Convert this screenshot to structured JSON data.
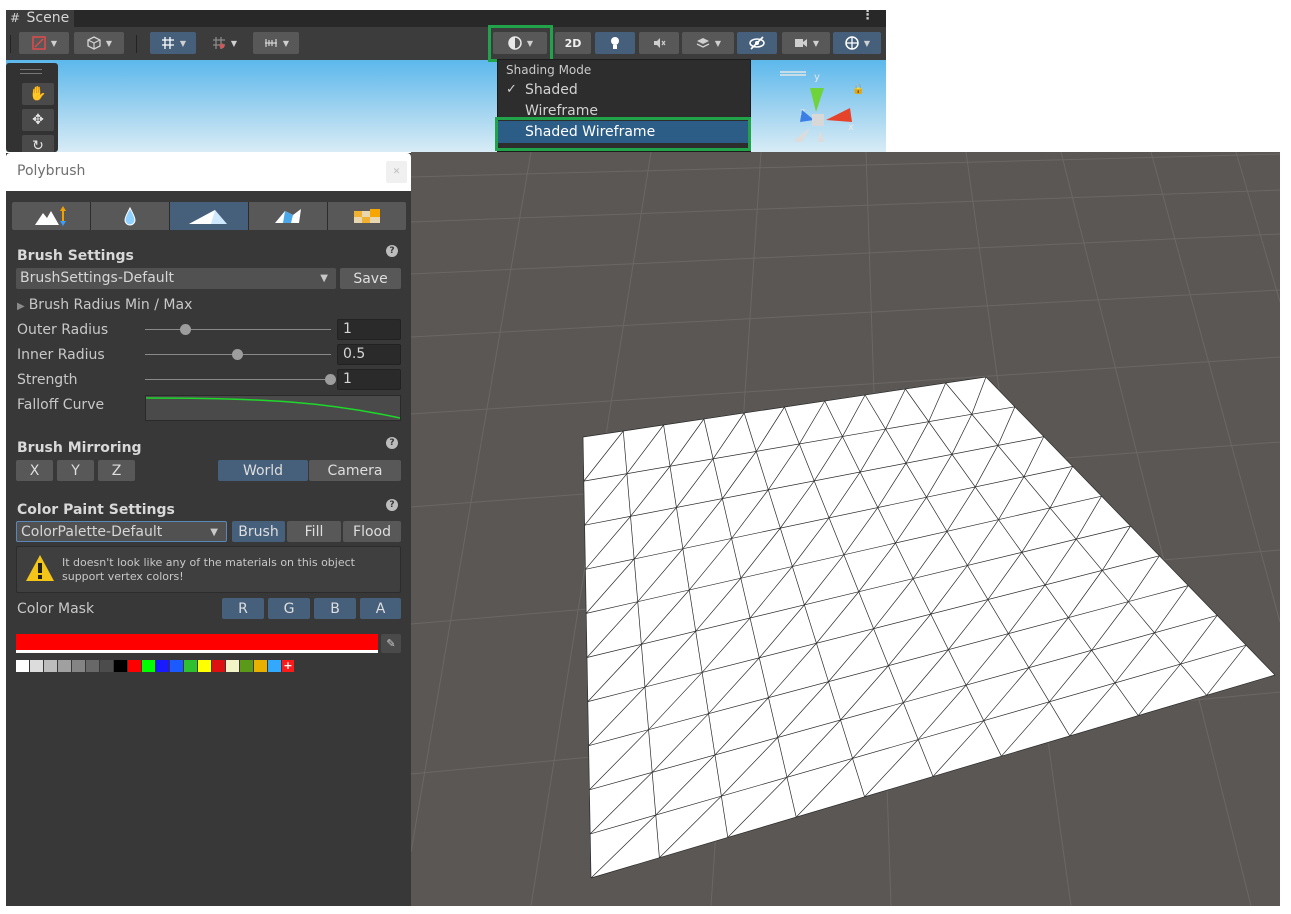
{
  "scene": {
    "tab_label": "Scene",
    "toolbar": {
      "two_d_label": "2D"
    },
    "shading_dropdown": {
      "title": "Shading Mode",
      "items": [
        {
          "label": "Shaded",
          "checked": true
        },
        {
          "label": "Wireframe",
          "checked": false
        },
        {
          "label": "Shaded Wireframe",
          "checked": false,
          "highlighted": true
        }
      ]
    },
    "gizmo": {
      "y": "y",
      "x": "x",
      "z": "z"
    }
  },
  "polybrush": {
    "title": "Polybrush",
    "modes": [
      {
        "icon": "raise-lower-icon"
      },
      {
        "icon": "smooth-droplet-icon"
      },
      {
        "icon": "paint-vertex-color-icon",
        "active": true
      },
      {
        "icon": "scatter-prefab-icon"
      },
      {
        "icon": "paint-texture-icon"
      }
    ],
    "brush_settings": {
      "title": "Brush Settings",
      "preset": "BrushSettings-Default",
      "save_label": "Save",
      "radius_foldout": "Brush Radius Min / Max",
      "outer_radius_label": "Outer Radius",
      "outer_radius_value": "1",
      "outer_radius_level": 0.22,
      "inner_radius_label": "Inner Radius",
      "inner_radius_value": "0.5",
      "inner_radius_level": 0.5,
      "strength_label": "Strength",
      "strength_value": "1",
      "strength_level": 1.0,
      "falloff_label": "Falloff Curve"
    },
    "brush_mirroring": {
      "title": "Brush Mirroring",
      "axes": [
        "X",
        "Y",
        "Z"
      ],
      "spaces": [
        {
          "label": "World",
          "active": true
        },
        {
          "label": "Camera",
          "active": false
        }
      ]
    },
    "color_paint": {
      "title": "Color Paint Settings",
      "palette": "ColorPalette-Default",
      "modes": [
        {
          "label": "Brush",
          "active": true
        },
        {
          "label": "Fill",
          "active": false
        },
        {
          "label": "Flood",
          "active": false
        }
      ],
      "warning": "It doesn't look like any of the materials on this object support vertex colors!",
      "mask_label": "Color Mask",
      "mask_channels": [
        "R",
        "G",
        "B",
        "A"
      ],
      "current_color": "#ff0000",
      "swatches": [
        "#ffffff",
        "#dcdcdc",
        "#bcbcbc",
        "#a0a0a0",
        "#848484",
        "#686868",
        "#4c4c4c",
        "#000000",
        "#ff0000",
        "#00ff00",
        "#1a1aff",
        "#1a5aff",
        "#2fc02f",
        "#ffff00",
        "#dd1111",
        "#f3f3c8",
        "#5a9a18",
        "#e8b000",
        "#33a8ff"
      ]
    }
  },
  "colors": {
    "accent_green": "#21a34a",
    "selection_blue": "#2c5d87",
    "active_button": "#46607c",
    "viewport_bg": "#5b5754"
  }
}
